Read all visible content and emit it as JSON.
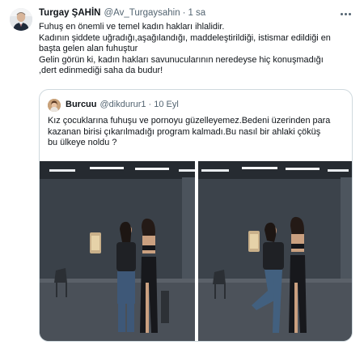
{
  "tweet": {
    "author_name": "Turgay ŞAHİN",
    "author_handle": "@Av_Turgaysahin",
    "separator": "·",
    "time": "1 sa",
    "lines": [
      "Fuhuş en önemli ve temel kadın hakları ihlalidir.",
      "Kadının şiddete uğradığı,aşağılandığı, maddeleştirildiği, istismar edildiği en",
      "başta gelen alan fuhuştur",
      "Gelin görün ki, kadın hakları savunucularının neredeyse hiç konuşmadığı",
      ",dert edinmediği saha da budur!"
    ]
  },
  "quoted": {
    "author_name": "Burcuu",
    "author_handle": "@dikdurur1",
    "separator": "·",
    "time": "10 Eyl",
    "lines": [
      "Kız çocuklarına fuhuşu ve pornoyu güzelleyemez.Bedeni üzerinden para",
      "kazanan birisi çıkarılmadığı program kalmadı.Bu nasıl bir ahlaki çöküş",
      "bu ülkeye noldu ?"
    ]
  },
  "icons": {
    "more": "more-horizontal-icon",
    "avatar": "profile-photo",
    "quoted_avatar": "profile-photo",
    "media": "studio-photo"
  },
  "colors": {
    "text": "#0f1419",
    "secondary_text": "#536471",
    "border": "#cfd9de",
    "background": "#ffffff"
  }
}
